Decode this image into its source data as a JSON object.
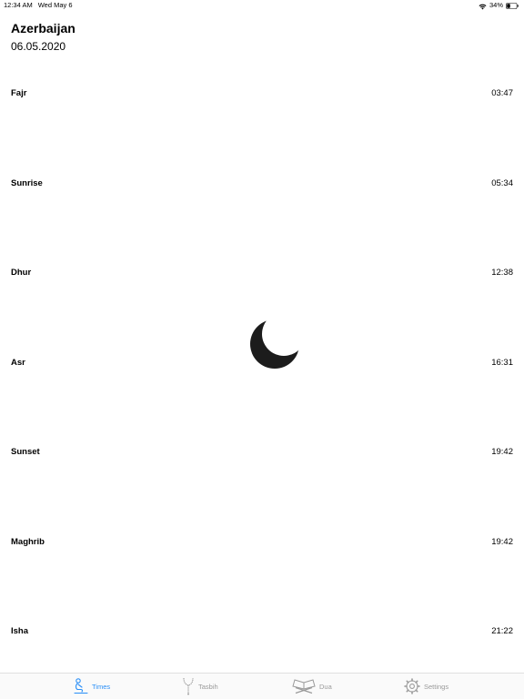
{
  "status_bar": {
    "time": "12:34 AM",
    "date": "Wed May 6",
    "battery": "34%"
  },
  "header": {
    "location": "Azerbaijan",
    "date": "06.05.2020"
  },
  "prayers": [
    {
      "name": "Fajr",
      "time": "03:47"
    },
    {
      "name": "Sunrise",
      "time": "05:34"
    },
    {
      "name": "Dhur",
      "time": "12:38"
    },
    {
      "name": "Asr",
      "time": "16:31"
    },
    {
      "name": "Sunset",
      "time": "19:42"
    },
    {
      "name": "Maghrib",
      "time": "19:42"
    },
    {
      "name": "Isha",
      "time": "21:22"
    }
  ],
  "tabs": [
    {
      "label": "Times",
      "icon": "prayer-person-icon",
      "active": true
    },
    {
      "label": "Tasbih",
      "icon": "tasbih-beads-icon",
      "active": false
    },
    {
      "label": "Dua",
      "icon": "book-stand-icon",
      "active": false
    },
    {
      "label": "Settings",
      "icon": "gear-icon",
      "active": false
    }
  ],
  "colors": {
    "accent": "#2a8ff7",
    "inactive_tab": "#9a9a9a",
    "crescent": "#1c1c1c"
  }
}
